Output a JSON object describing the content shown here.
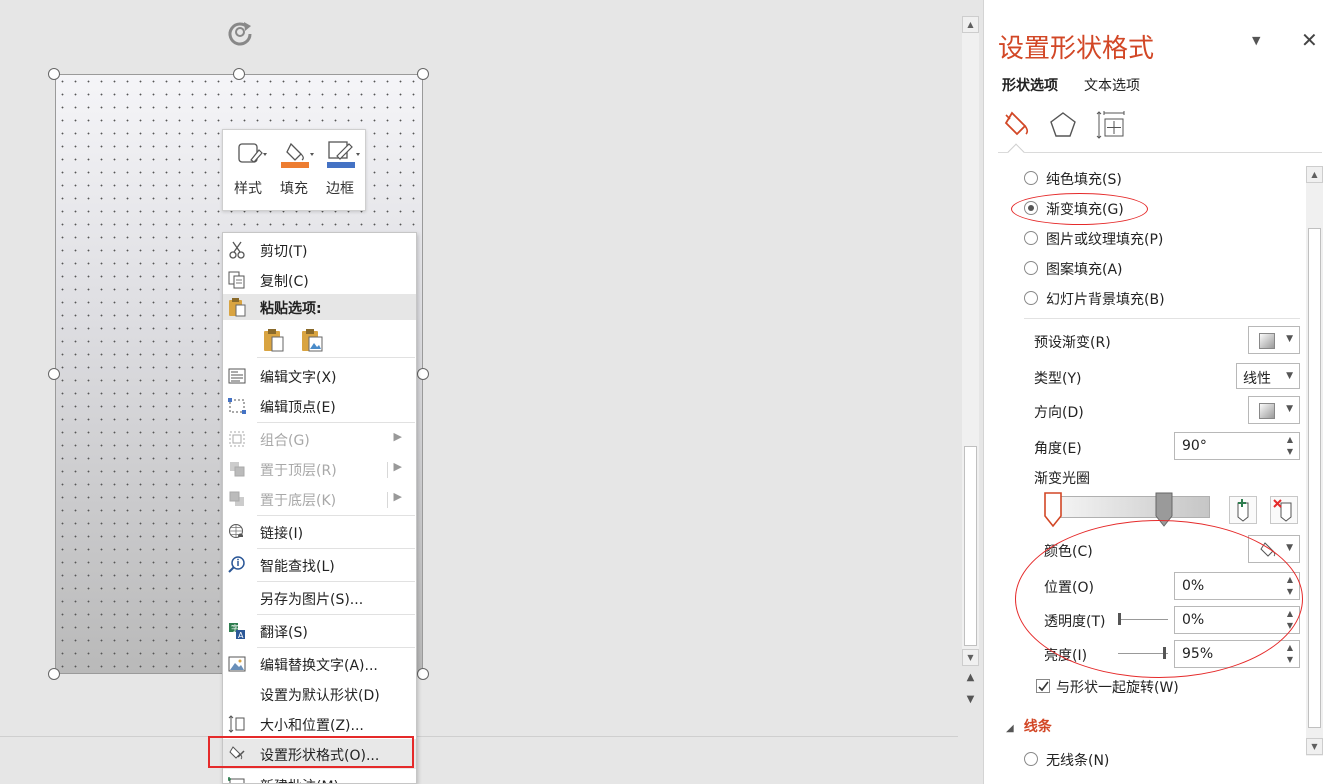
{
  "mini_toolbar": {
    "style_label": "样式",
    "fill_label": "填充",
    "border_label": "边框"
  },
  "context_menu": {
    "cut": "剪切(T)",
    "copy": "复制(C)",
    "paste_header": "粘贴选项:",
    "edit_text": "编辑文字(X)",
    "edit_points": "编辑顶点(E)",
    "group": "组合(G)",
    "bring_front": "置于顶层(R)",
    "send_back": "置于底层(K)",
    "link": "链接(I)",
    "smart_lookup": "智能查找(L)",
    "save_as_picture": "另存为图片(S)...",
    "translate": "翻译(S)",
    "edit_alt_text": "编辑替换文字(A)...",
    "set_default_shape": "设置为默认形状(D)",
    "size_position": "大小和位置(Z)...",
    "format_shape": "设置形状格式(O)...",
    "new_comment": "新建批注(M)"
  },
  "format_pane": {
    "title": "设置形状格式",
    "tabs": {
      "shape_options": "形状选项",
      "text_options": "文本选项"
    },
    "fill_options": {
      "solid": "纯色填充(S)",
      "gradient": "渐变填充(G)",
      "picture_texture": "图片或纹理填充(P)",
      "pattern": "图案填充(A)",
      "slide_background": "幻灯片背景填充(B)",
      "selected": "gradient"
    },
    "preset_gradient": "预设渐变(R)",
    "type": {
      "label": "类型(Y)",
      "value": "线性"
    },
    "direction": "方向(D)",
    "angle": {
      "label": "角度(E)",
      "value": "90°"
    },
    "gradient_stops": "渐变光圈",
    "color": "颜色(C)",
    "position": {
      "label": "位置(O)",
      "value": "0%"
    },
    "transparency": {
      "label": "透明度(T)",
      "value": "0%",
      "level": 0
    },
    "brightness": {
      "label": "亮度(I)",
      "value": "95%",
      "level": 0.95
    },
    "rotate_with_shape": {
      "label": "与形状一起旋转(W)",
      "checked": true
    },
    "line_section": "线条",
    "no_line": "无线条(N)"
  },
  "colors": {
    "accent": "#d24726",
    "annotation_red": "#e52a2a",
    "fill_orange": "#ed7d31",
    "border_blue": "#4472c4"
  }
}
